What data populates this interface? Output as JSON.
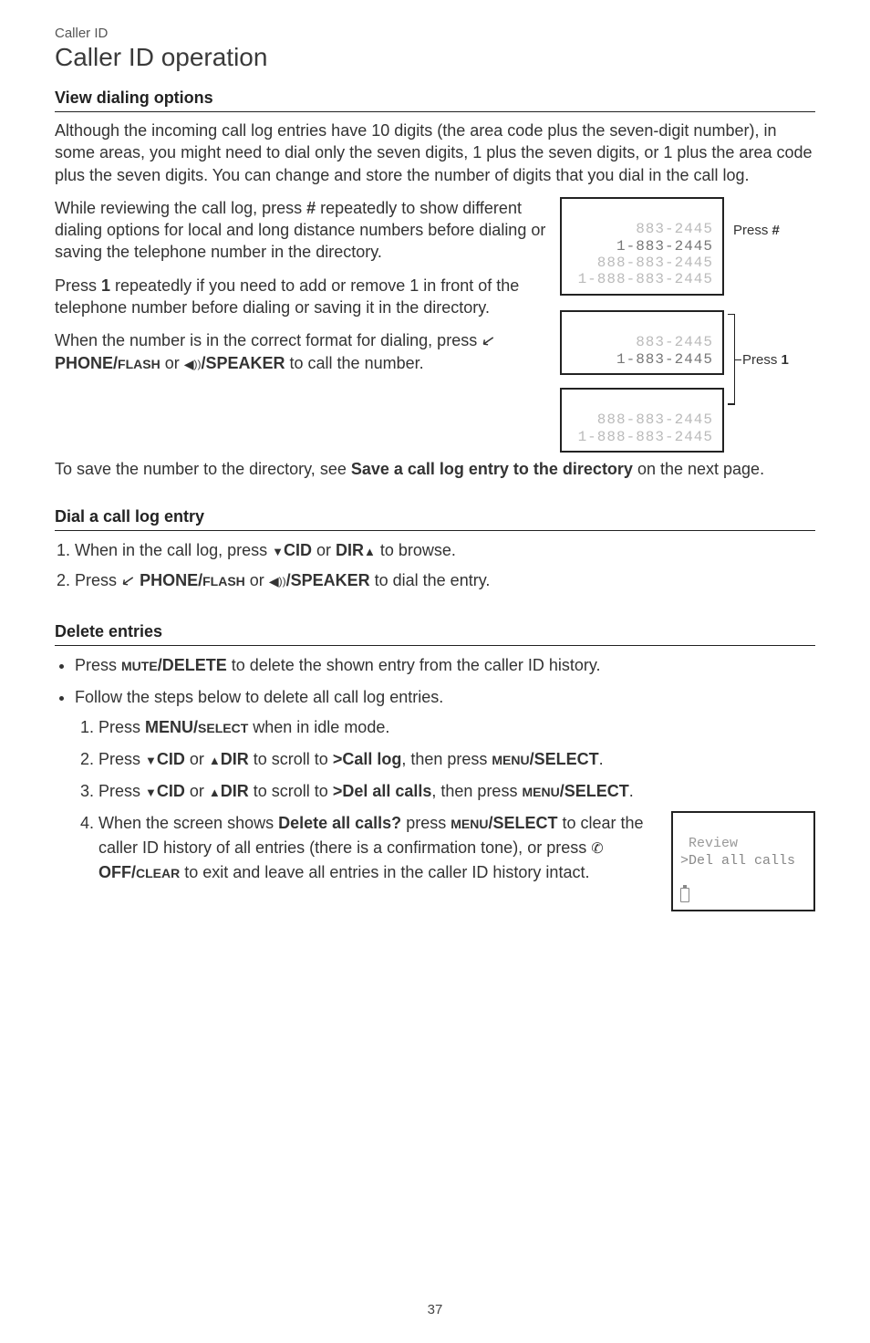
{
  "header": {
    "breadcrumb": "Caller ID",
    "title": "Caller ID operation"
  },
  "section1": {
    "title": "View dialing options",
    "para1": "Although the incoming call log entries have 10 digits (the area code plus the seven-digit number), in some areas, you might need to dial only the seven digits, 1 plus the seven digits, or 1 plus the area code plus the seven digits. You can change and store the number of digits that you dial in the call log.",
    "para2_a": "While reviewing the call log, press ",
    "para2_key": "#",
    "para2_b": " repeatedly to show different dialing options for local and long distance numbers before dialing or saving the telephone number in the directory.",
    "para3_a": "Press ",
    "para3_key": "1",
    "para3_b": " repeatedly if you need to add or remove 1 in front of the telephone number before dialing or saving it in the directory.",
    "para4_a": "When the number is in the correct format for dialing, press ",
    "para4_key1a": " PHONE/",
    "para4_key1b": "FLASH",
    "para4_mid": " or ",
    "para4_key2a": "/SPEAKER",
    "para4_b": " to call the number.",
    "para5_a": "To save the number to the directory, see ",
    "para5_bold": "Save a call log entry to the directory",
    "para5_b": " on the next page."
  },
  "lcd_hash": {
    "l1": "883-2445",
    "l2": "1-883-2445",
    "l3": "888-883-2445",
    "l4": "1-888-883-2445",
    "label_a": "Press ",
    "label_b": "#"
  },
  "lcd_one_top": {
    "l1": "883-2445",
    "l2": "1-883-2445"
  },
  "lcd_one_bot": {
    "l1": "888-883-2445",
    "l2": "1-888-883-2445"
  },
  "lcd_one_label": {
    "a": "Press ",
    "b": "1"
  },
  "section2": {
    "title": "Dial a call log entry",
    "step1_a": "When in the call log, press ",
    "step1_key1": "CID",
    "step1_mid": " or ",
    "step1_key2": "DIR",
    "step1_b": " to browse.",
    "step2_a": "Press ",
    "step2_key1a": "  PHONE/",
    "step2_key1b": "FLASH",
    "step2_mid": " or ",
    "step2_key2a": "/SPEAKER",
    "step2_b": " to dial the entry."
  },
  "section3": {
    "title": "Delete entries",
    "bul1_a": "Press ",
    "bul1_key_a": "MUTE",
    "bul1_key_b": "/DELETE",
    "bul1_b": " to delete the shown entry from the caller ID history.",
    "bul2": "Follow the steps below to delete all call log entries.",
    "s1_a": "Press ",
    "s1_key_a": "MENU/",
    "s1_key_b": "SELECT",
    "s1_b": " when in idle mode.",
    "s2_a": "Press ",
    "s2_k1": "CID",
    "s2_mid": " or ",
    "s2_k2": "DIR",
    "s2_b": " to scroll to ",
    "s2_bold": ">Call log",
    "s2_c": ", then press ",
    "s2_key_a": "MENU",
    "s2_key_b": "/SELECT",
    "s2_d": ".",
    "s3_a": "Press ",
    "s3_k1": "CID",
    "s3_mid": " or ",
    "s3_k2": "DIR",
    "s3_b": " to scroll to ",
    "s3_bold": ">Del all calls",
    "s3_c": ", then press ",
    "s3_key_a": "MENU",
    "s3_key_b": "/SELECT",
    "s3_d": ".",
    "s4_a": "When the screen shows ",
    "s4_bold": "Delete all calls?",
    "s4_b": " press ",
    "s4_key1_a": "MENU",
    "s4_key1_b": "/SELECT",
    "s4_c": " to clear the caller ID history of all entries (there is a confirmation tone), or press ",
    "s4_key2_a": " OFF/",
    "s4_key2_b": "CLEAR",
    "s4_d": " to exit and leave all entries in the caller ID history intact."
  },
  "lcd_menu": {
    "l1": " Review",
    "l2": ">Del all calls"
  },
  "page_number": "37"
}
